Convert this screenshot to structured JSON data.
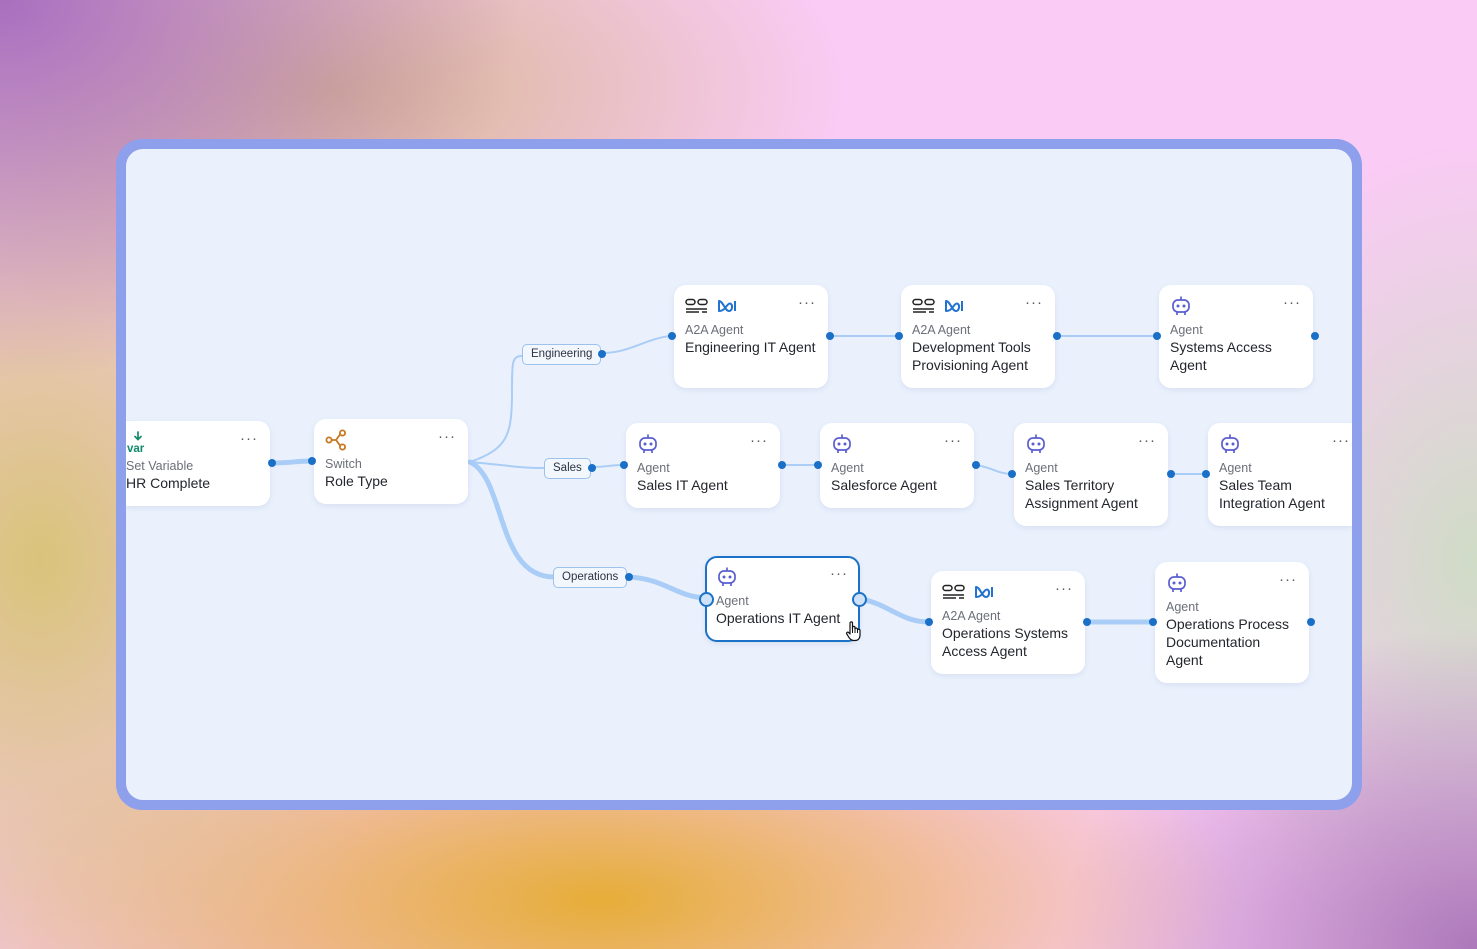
{
  "nodes": {
    "hr_complete": {
      "type": "Set Variable",
      "label": "HR Complete",
      "icon": "var-download-icon"
    },
    "role_type": {
      "type": "Switch",
      "label": "Role Type",
      "icon": "switch-branch-icon"
    },
    "eng_it": {
      "type": "A2A Agent",
      "label": "Engineering IT Agent",
      "icon": "a2a-agent-icon"
    },
    "dev_tools": {
      "type": "A2A Agent",
      "label": "Development Tools Provisioning Agent",
      "icon": "a2a-agent-icon"
    },
    "systems_access": {
      "type": "Agent",
      "label": "Systems Access Agent",
      "icon": "robot-icon"
    },
    "sales_it": {
      "type": "Agent",
      "label": "Sales IT Agent",
      "icon": "robot-icon"
    },
    "salesforce": {
      "type": "Agent",
      "label": "Salesforce Agent",
      "icon": "robot-icon"
    },
    "sales_territory": {
      "type": "Agent",
      "label": "Sales Territory Assignment Agent",
      "icon": "robot-icon"
    },
    "sales_team": {
      "type": "Agent",
      "label": "Sales Team Integration Agent",
      "icon": "robot-icon"
    },
    "ops_it": {
      "type": "Agent",
      "label": "Operations IT Agent",
      "icon": "robot-icon",
      "selected": true
    },
    "ops_systems": {
      "type": "A2A Agent",
      "label": "Operations Systems Access Agent",
      "icon": "a2a-agent-icon"
    },
    "ops_process": {
      "type": "Agent",
      "label": "Operations Process Documentation Agent",
      "icon": "robot-icon"
    }
  },
  "branches": {
    "engineering": "Engineering",
    "sales": "Sales",
    "operations": "Operations"
  },
  "menu_glyph": "···",
  "colors": {
    "frame": "#8e9fec",
    "canvas": "#eaf1fd",
    "edge": "#a9cdf6",
    "port": "#1a70c6",
    "selected_border": "#1c72c7",
    "agent_icon": "#5b5fcf",
    "switch_icon": "#c8781f",
    "var_icon": "#0f8a6a"
  }
}
